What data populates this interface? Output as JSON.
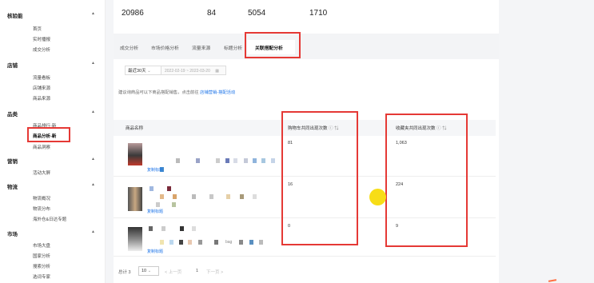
{
  "sidebar": {
    "sections": [
      {
        "title": "核验能",
        "items": [
          "首页",
          "实时播报",
          "成交分析"
        ]
      },
      {
        "title": "店铺",
        "items": [
          "流量看板",
          "店铺来源",
          "商品来源"
        ]
      },
      {
        "title": "品类",
        "items": [
          "商品排行-新",
          "商品分析-新",
          "商品洞察"
        ]
      },
      {
        "title": "营销",
        "items": [
          "活动大屏"
        ]
      },
      {
        "title": "物流",
        "items": [
          "物流概况",
          "物流分布",
          "海外仓&日达专题"
        ]
      },
      {
        "title": "市场",
        "items": [
          "市场大盘",
          "国家分析",
          "搜索分析",
          "选词专家"
        ]
      }
    ]
  },
  "stats": [
    "20986",
    "84",
    "5054",
    "1710"
  ],
  "tabs": [
    "成交分析",
    "市场价格分析",
    "流量来源",
    "标题分析",
    "关联搭配分析"
  ],
  "filters": {
    "period": "最近30天",
    "range": "2022-02-19 ~ 2022-03-20"
  },
  "tip": {
    "text": "建议询商品可以下商品搭配销售，点击前往",
    "link": "店铺营销-搭配活动"
  },
  "table": {
    "headers": [
      "商品名称",
      "购物车共同出现次数",
      "收藏夹共同出现次数"
    ],
    "rows": [
      {
        "cart": "81",
        "fav": "1,063",
        "copy": "复制标题"
      },
      {
        "cart": "16",
        "fav": "224",
        "copy": "复制标题"
      },
      {
        "cart": "0",
        "fav": "9",
        "copy": "复制标题",
        "tag": "bag"
      }
    ]
  },
  "pager": {
    "total": "总计 3",
    "size": "10",
    "prev": "< 上一页",
    "current": "1",
    "next": "下一页 >"
  },
  "colors": {
    "highlight": "#e53935",
    "link": "#1a73e8",
    "cursor_dot": "#f7dd16"
  }
}
